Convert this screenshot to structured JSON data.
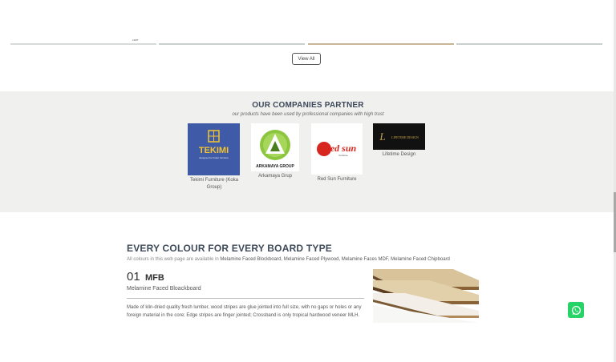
{
  "products": {
    "tag": "LIMIT",
    "view_all_label": "View All"
  },
  "partners": {
    "title": "OUR COMPANIES PARTNER",
    "subtitle": "our products have been used by professional companies with high trust",
    "items": [
      {
        "name": "Tekimi Furniture (Koka Group)",
        "logo_text": "TEKIMI",
        "logo_sub": "designed for better furniture"
      },
      {
        "name": "Arkamaya Grup",
        "logo_text": "ARKAMAYA GROUP"
      },
      {
        "name": "Red Sun Furniture",
        "logo_text": "Red sun",
        "logo_sub": "furniture"
      },
      {
        "name": "Lifetime Design",
        "logo_text": "LIFETIME DESIGN"
      }
    ]
  },
  "board": {
    "title": "EVERY COLOUR FOR EVERY BOARD TYPE",
    "intro_prefix": "All colours in this web page are available in",
    "intro_types": "Melamine Faced Blockboard, Melamine Faced Plywood, Melamine Faces MDF, Melamine Faced Chipboard",
    "number": "01",
    "code": "MFB",
    "name": "Melamine Faced Bloackboard",
    "description": "Made of klin-dried quality fresh lumber, wood stripes are glue jointed into full size, with no gaps or holes or any foreign material in the core; Edge stripes are finger jointed; Crossband is only tropical hardwood veneer MLH."
  },
  "colors": {
    "section_bg": "#f0f0ef",
    "heading": "#3e4a5a",
    "whatsapp": "#25d366",
    "tekimi_blue": "#3f5aa6",
    "ark_green": "#8cc63f",
    "redsun_red": "#d7261e"
  },
  "icons": {
    "whatsapp": "whatsapp-icon"
  }
}
